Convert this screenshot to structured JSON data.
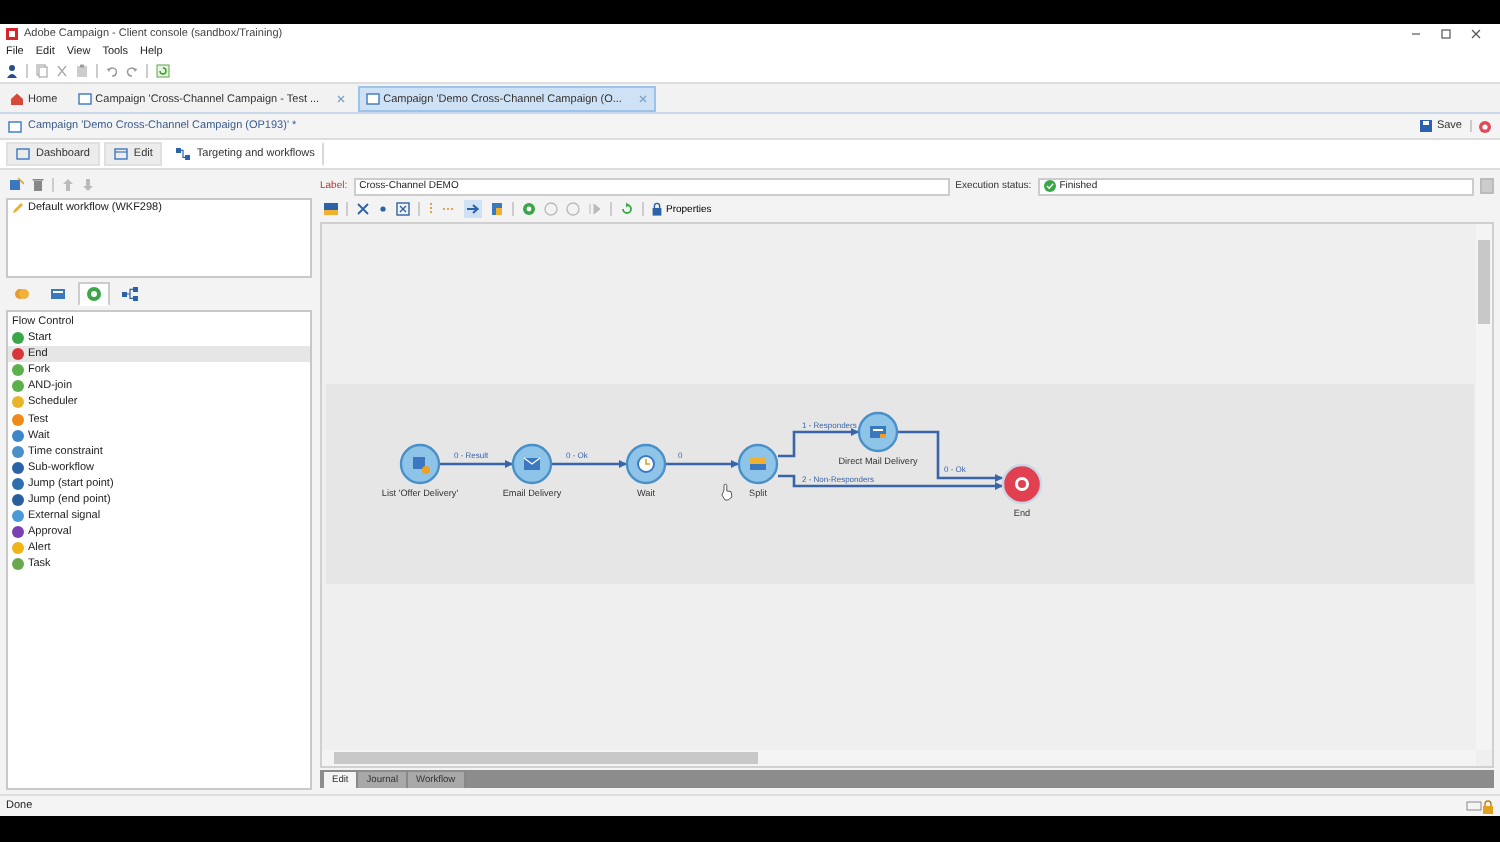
{
  "window": {
    "title": "Adobe Campaign - Client console (sandbox/Training)"
  },
  "menu": [
    "File",
    "Edit",
    "View",
    "Tools",
    "Help"
  ],
  "doc_tabs": [
    {
      "label": "Home",
      "kind": "home",
      "selected": false
    },
    {
      "label": "Campaign 'Cross-Channel Campaign - Test ...",
      "kind": "document",
      "selected": false
    },
    {
      "label": "Campaign 'Demo Cross-Channel Campaign (O...",
      "kind": "document",
      "selected": true
    }
  ],
  "document": {
    "title": "Campaign 'Demo Cross-Channel Campaign (OP193)' *",
    "save": "Save"
  },
  "view_tabs": [
    {
      "label": "Dashboard",
      "selected": false
    },
    {
      "label": "Edit",
      "selected": false
    },
    {
      "label": "Targeting and workflows",
      "selected": true
    }
  ],
  "workflows": [
    {
      "label": "Default workflow (WKF298)",
      "selected": false
    }
  ],
  "palette_tabs": [
    {
      "kind": "targeting",
      "selected": false
    },
    {
      "kind": "actions",
      "selected": false
    },
    {
      "kind": "flow",
      "selected": true
    },
    {
      "kind": "tools",
      "selected": false
    }
  ],
  "palette": {
    "group": "Flow Control",
    "items": [
      {
        "label": "Start",
        "color": "#3aa648",
        "selected": false
      },
      {
        "label": "End",
        "color": "#d8363a",
        "selected": true
      },
      {
        "label": "Fork",
        "color": "#5bb04a",
        "selected": false
      },
      {
        "label": "AND-join",
        "color": "#5bb04a",
        "selected": false
      },
      {
        "label": "Scheduler",
        "color": "#e8b52a",
        "selected": false
      },
      {
        "label": "Test",
        "color": "#ef8a1a",
        "selected": false
      },
      {
        "label": "Wait",
        "color": "#3f86c8",
        "selected": false
      },
      {
        "label": "Time constraint",
        "color": "#4a90c8",
        "selected": false
      },
      {
        "label": "Sub-workflow",
        "color": "#2c62a8",
        "selected": false
      },
      {
        "label": "Jump (start point)",
        "color": "#2f6fb0",
        "selected": false
      },
      {
        "label": "Jump (end point)",
        "color": "#2a5f9e",
        "selected": false
      },
      {
        "label": "External signal",
        "color": "#4a9ad8",
        "selected": false
      },
      {
        "label": "Approval",
        "color": "#7a3fb0",
        "selected": false
      },
      {
        "label": "Alert",
        "color": "#f0b418",
        "selected": false
      },
      {
        "label": "Task",
        "color": "#6aa84f",
        "selected": false
      }
    ]
  },
  "workflow": {
    "label_caption": "Label:",
    "label": "Cross-Channel DEMO",
    "status_caption": "Execution status:",
    "status": "Finished",
    "properties": "Properties",
    "nodes": [
      {
        "label": "List 'Offer Delivery'",
        "kind": "list"
      },
      {
        "label": "Email Delivery",
        "kind": "email"
      },
      {
        "label": "Wait",
        "kind": "wait"
      },
      {
        "label": "Split",
        "kind": "split"
      },
      {
        "label": "Direct Mail Delivery",
        "kind": "mail"
      },
      {
        "label": "End",
        "kind": "end"
      }
    ],
    "transitions": [
      {
        "label": "0 - Result"
      },
      {
        "label": "0 - Ok"
      },
      {
        "label": "0"
      },
      {
        "label": "1 - Responders"
      },
      {
        "label": "2 - Non-Responders"
      },
      {
        "label": "0 - Ok"
      }
    ]
  },
  "bottom_tabs": [
    {
      "label": "Edit",
      "selected": true
    },
    {
      "label": "Journal",
      "selected": false
    },
    {
      "label": "Workflow",
      "selected": false
    }
  ],
  "status_bar": "Done"
}
